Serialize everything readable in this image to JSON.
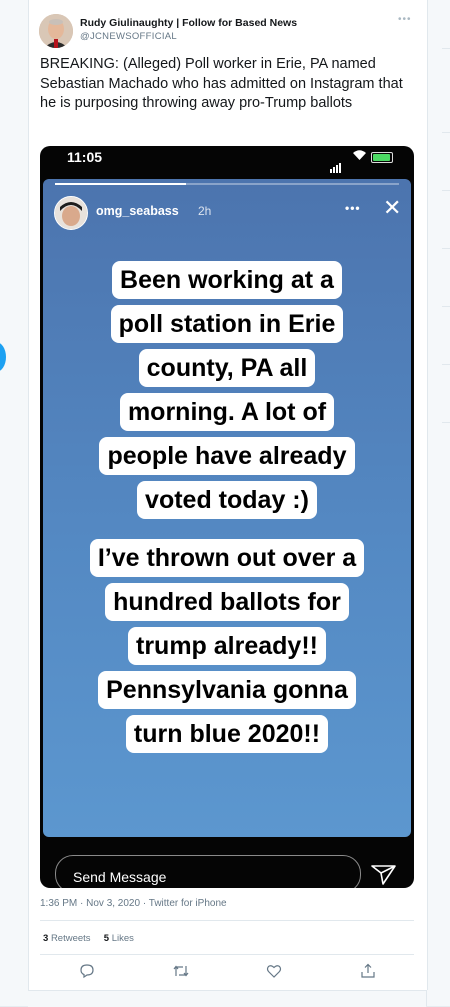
{
  "tweet": {
    "display_name": "Rudy Giulinaughty | Follow for Based News",
    "handle": "@JCNEWSOFFICIAL",
    "text": "BREAKING: (Alleged) Poll worker in Erie, PA named Sebastian Machado who has admitted on Instagram that he is purposing throwing away pro-Trump ballots",
    "timestamp": "1:36 PM · Nov 3, 2020 · Twitter for iPhone",
    "retweets": {
      "count": "3",
      "label": "Retweets"
    },
    "likes": {
      "count": "5",
      "label": "Likes"
    }
  },
  "screenshot": {
    "clock": "11:05",
    "story_progress": 0.38,
    "username": "omg_seabass",
    "age": "2h",
    "message_placeholder": "Send Message",
    "text_block_1": [
      "Been working at a",
      "poll station in Erie",
      "county, PA all",
      "morning. A lot of",
      "people have already",
      "voted today :)"
    ],
    "text_block_2": [
      "I’ve thrown out over a",
      "hundred ballots for",
      "trump already!!",
      "Pennsylvania gonna",
      "turn blue 2020!!"
    ]
  },
  "icons": [
    "reply-icon",
    "retweet-icon",
    "like-icon",
    "share-icon",
    "send-icon",
    "close-icon",
    "more-icon",
    "wifi-icon",
    "battery-icon",
    "signal-icon"
  ],
  "colors": {
    "accent": "#1da1f2",
    "story_top": "#4c74ae",
    "story_bottom": "#5c97cf",
    "secondary_text": "#657786"
  }
}
